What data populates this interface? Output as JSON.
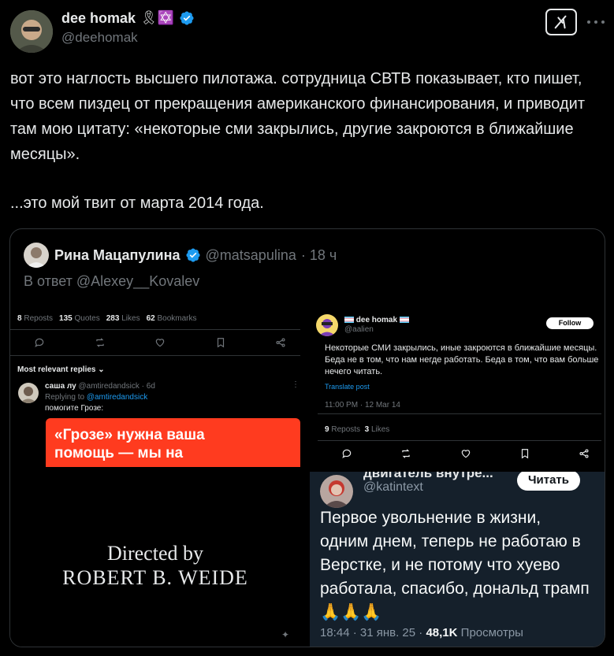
{
  "author": {
    "name": "dee homak",
    "emoji": "🎗✡️",
    "handle": "@deehomak"
  },
  "tweet_text_1": "вот это наглость высшего пилотажа. сотрудница СВТВ показывает, кто пишет, что всем пиздец от прекращения американского финансирования, и приводит там мою цитату: «некоторые сми закрылись, другие закроются в ближайшие месяцы».",
  "tweet_text_2": "...это мой твит от марта 2014 года.",
  "quoted": {
    "name": "Рина Мацапулина",
    "handle": "@matsapulina",
    "time": "· 18 ч",
    "reply_to": "В ответ @Alexey__Kovalev"
  },
  "left_panel": {
    "stats": [
      {
        "num": "8",
        "label": "Reposts"
      },
      {
        "num": "135",
        "label": "Quotes"
      },
      {
        "num": "283",
        "label": "Likes"
      },
      {
        "num": "62",
        "label": "Bookmarks"
      }
    ],
    "sort_label": "Most relevant replies",
    "reply": {
      "name": "саша лу",
      "handle": "@amtiredandsick · 6d",
      "replying_prefix": "Replying to",
      "replying_to": "@amtiredandsick",
      "text": "помогите Грозе:",
      "banner": "«Грозе» нужна ваша помощь — мы на грани"
    },
    "credits_line1": "Directed by",
    "credits_line2": "ROBERT B. WEIDE"
  },
  "right_panel": {
    "name": "dee homak",
    "handle": "@aalien",
    "follow_label": "Follow",
    "text": "Некоторые СМИ закрылись, иные закроются в ближайшие месяцы. Беда не в том, что нам негде работать. Беда в том, что вам больше нечего читать.",
    "translate": "Translate post",
    "timestamp": "11:00 PM · 12 Mar 14",
    "stats": [
      {
        "num": "9",
        "label": "Reposts"
      },
      {
        "num": "3",
        "label": "Likes"
      }
    ]
  },
  "bottom_right": {
    "name": "двигатель внутре...",
    "handle": "@katintext",
    "read_label": "Читать",
    "text": "Первое увольнение в жизни, одним днем, теперь не работаю в Верстке, и не потому что хуево работала, спасибо, дональд трамп 🙏🙏🙏",
    "meta": "18:44 · 31 янв. 25 ·",
    "views_num": "48,1K",
    "views_label": "Просмотры"
  },
  "colors": {
    "accent": "#1d9bf0",
    "banner": "#ff3b1f"
  }
}
